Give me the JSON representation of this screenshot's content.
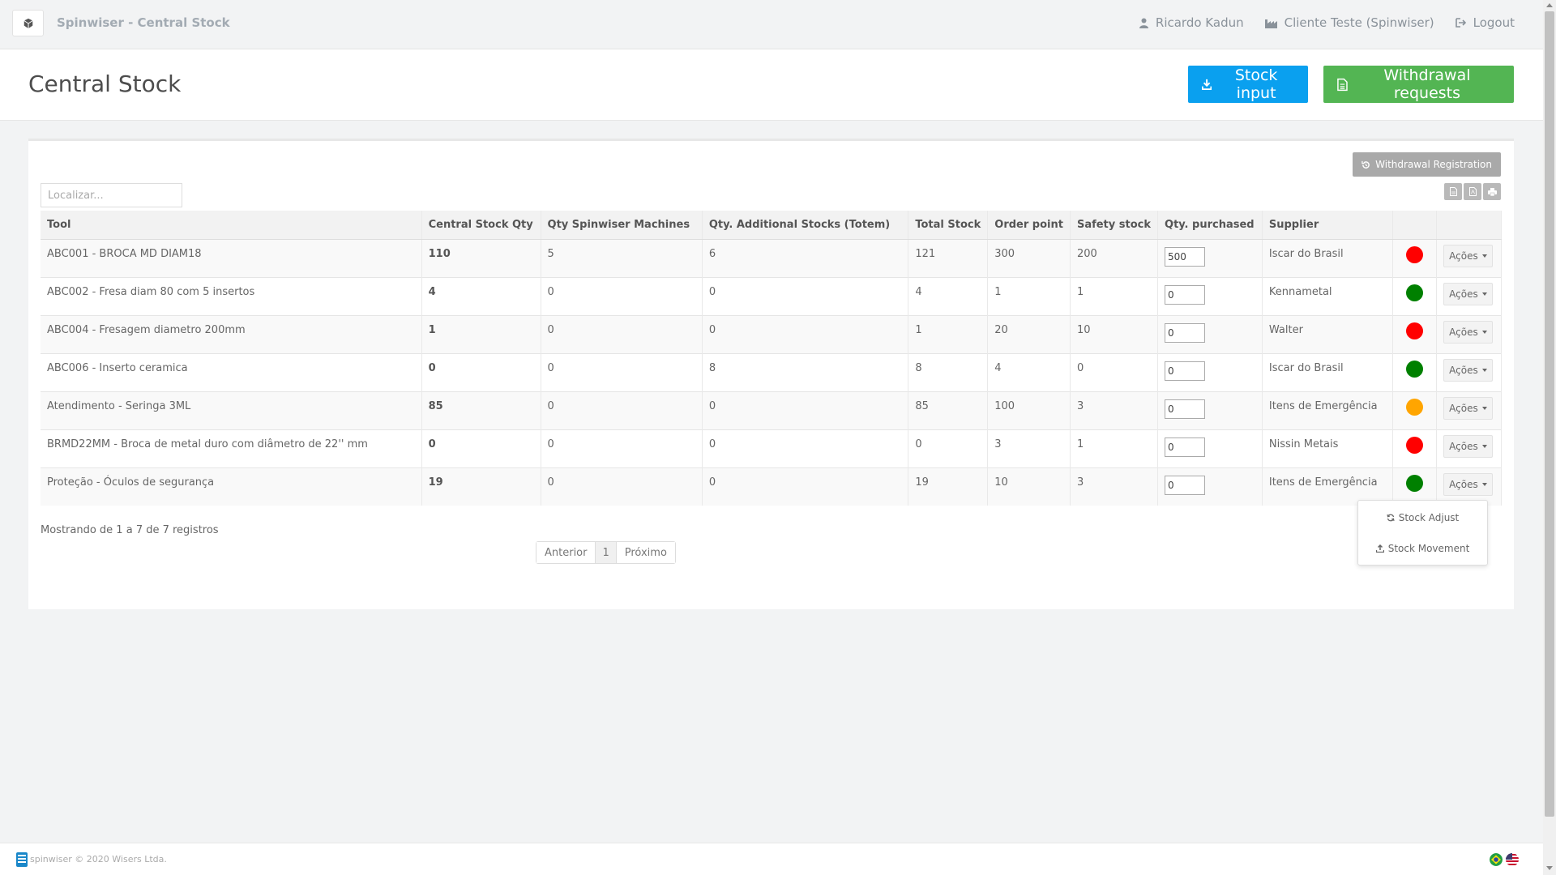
{
  "navbar": {
    "brand_title": "Spinwiser - Central Stock",
    "user_name": "Ricardo Kadun",
    "client_name": "Cliente Teste (Spinwiser)",
    "logout_label": "Logout"
  },
  "header": {
    "title": "Central Stock",
    "stock_input_label": "Stock input",
    "withdrawal_requests_label": "Withdrawal requests"
  },
  "panel": {
    "withdrawal_registration_label": "Withdrawal Registration",
    "search_placeholder": "Localizar..."
  },
  "table": {
    "columns": [
      "Tool",
      "Central Stock Qty",
      "Qty Spinwiser Machines",
      "Qty. Additional Stocks (Totem)",
      "Total Stock",
      "Order point",
      "Safety stock",
      "Qty. purchased",
      "Supplier",
      "",
      ""
    ],
    "actions_label": "Ações",
    "rows": [
      {
        "tool": "ABC001 - BROCA MD DIAM18",
        "central": "110",
        "machines": "5",
        "additional": "6",
        "total": "121",
        "order_point": "300",
        "safety": "200",
        "purchased": "500",
        "supplier": "Iscar do Brasil",
        "status_color": "#ff0000"
      },
      {
        "tool": "ABC002 - Fresa diam 80 com 5 insertos",
        "central": "4",
        "machines": "0",
        "additional": "0",
        "total": "4",
        "order_point": "1",
        "safety": "1",
        "purchased": "0",
        "supplier": "Kennametal",
        "status_color": "#008000"
      },
      {
        "tool": "ABC004 - Fresagem diametro 200mm",
        "central": "1",
        "machines": "0",
        "additional": "0",
        "total": "1",
        "order_point": "20",
        "safety": "10",
        "purchased": "0",
        "supplier": "Walter",
        "status_color": "#ff0000"
      },
      {
        "tool": "ABC006 - Inserto ceramica",
        "central": "0",
        "machines": "0",
        "additional": "8",
        "total": "8",
        "order_point": "4",
        "safety": "0",
        "purchased": "0",
        "supplier": "Iscar do Brasil",
        "status_color": "#008000"
      },
      {
        "tool": "Atendimento - Seringa 3ML",
        "central": "85",
        "machines": "0",
        "additional": "0",
        "total": "85",
        "order_point": "100",
        "safety": "3",
        "purchased": "0",
        "supplier": "Itens de Emergência",
        "status_color": "#ffa500"
      },
      {
        "tool": "BRMD22MM - Broca de metal duro com diâmetro de 22'' mm",
        "central": "0",
        "machines": "0",
        "additional": "0",
        "total": "0",
        "order_point": "3",
        "safety": "1",
        "purchased": "0",
        "supplier": "Nissin Metais",
        "status_color": "#ff0000"
      },
      {
        "tool": "Proteção - Óculos de segurança",
        "central": "19",
        "machines": "0",
        "additional": "0",
        "total": "19",
        "order_point": "10",
        "safety": "3",
        "purchased": "0",
        "supplier": "Itens de Emergência",
        "status_color": "#008000"
      }
    ]
  },
  "records_info": "Mostrando de 1 a 7 de 7 registros",
  "pagination": {
    "prev": "Anterior",
    "current": "1",
    "next": "Próximo"
  },
  "dropdown": {
    "items": [
      "Stock Adjust",
      "Stock Movement"
    ]
  },
  "footer": {
    "text": "spinwiser © 2020 Wisers Ltda."
  }
}
